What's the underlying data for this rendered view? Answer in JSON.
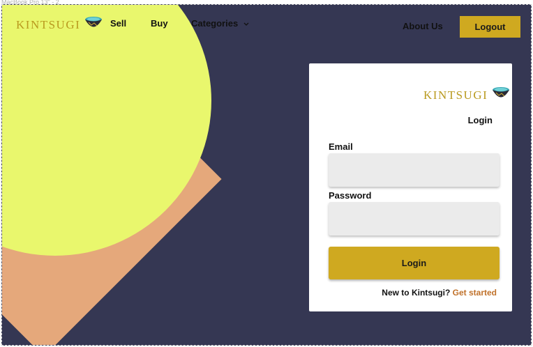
{
  "frame": {
    "label": "MacBook Pro 13\" - 2"
  },
  "brand": {
    "name": "KINTSUGI",
    "logo_icon": "bowl-icon",
    "gold": "#cfa920",
    "navy": "#353753"
  },
  "nav": {
    "sell": "Sell",
    "buy": "Buy",
    "categories": "Categories",
    "categories_icon": "chevron-down-icon",
    "about": "About Us",
    "logout": "Logout"
  },
  "login": {
    "title": "Login",
    "email_label": "Email",
    "email_value": "",
    "password_label": "Password",
    "password_value": "",
    "submit": "Login",
    "signup_prompt": "New to Kintsugi?",
    "signup_link": "Get  started"
  }
}
